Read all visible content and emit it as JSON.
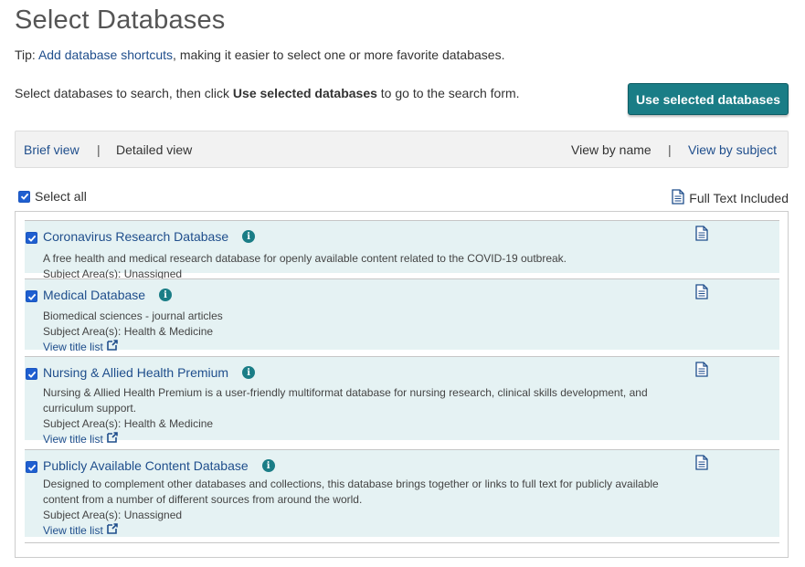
{
  "page": {
    "title": "Select Databases",
    "tip_prefix": "Tip: ",
    "tip_link": "Add database shortcuts",
    "tip_suffix": ", making it easier to select one or more favorite databases.",
    "instr_prefix": "Select databases to search, then click ",
    "instr_bold": "Use selected databases",
    "instr_suffix": " to go to the search form.",
    "use_button": "Use selected databases"
  },
  "viewbar": {
    "brief": "Brief view",
    "separator": "|",
    "detailed": "Detailed view",
    "by_name": "View by name",
    "by_subject": "View by subject"
  },
  "list": {
    "select_all": "Select all",
    "full_text_legend": "Full Text Included",
    "items": [
      {
        "title": "Coronavirus Research Database",
        "desc": "A free health and medical research database for openly available content related to the COVID-19 outbreak.",
        "subject": "Subject Area(s): Unassigned",
        "title_list": ""
      },
      {
        "title": "Medical Database",
        "desc": "Biomedical sciences - journal articles",
        "subject": "Subject Area(s): Health & Medicine",
        "title_list": "View title list"
      },
      {
        "title": "Nursing & Allied Health Premium",
        "desc": "Nursing & Allied Health Premium is a user-friendly multiformat database for nursing research, clinical skills development, and curriculum support.",
        "subject": "Subject Area(s): Health & Medicine",
        "title_list": "View title list"
      },
      {
        "title": "Publicly Available Content Database",
        "desc": "Designed to complement other databases and collections, this database brings together or links to full text for publicly available content from a number of different sources from around the world.",
        "subject": "Subject Area(s): Unassigned",
        "title_list": "View title list"
      }
    ]
  },
  "colors": {
    "accent": "#1a7d86",
    "link": "#1f4e8c",
    "item_bg": "#e5f2f3",
    "checkbox": "#1f5fd0"
  }
}
